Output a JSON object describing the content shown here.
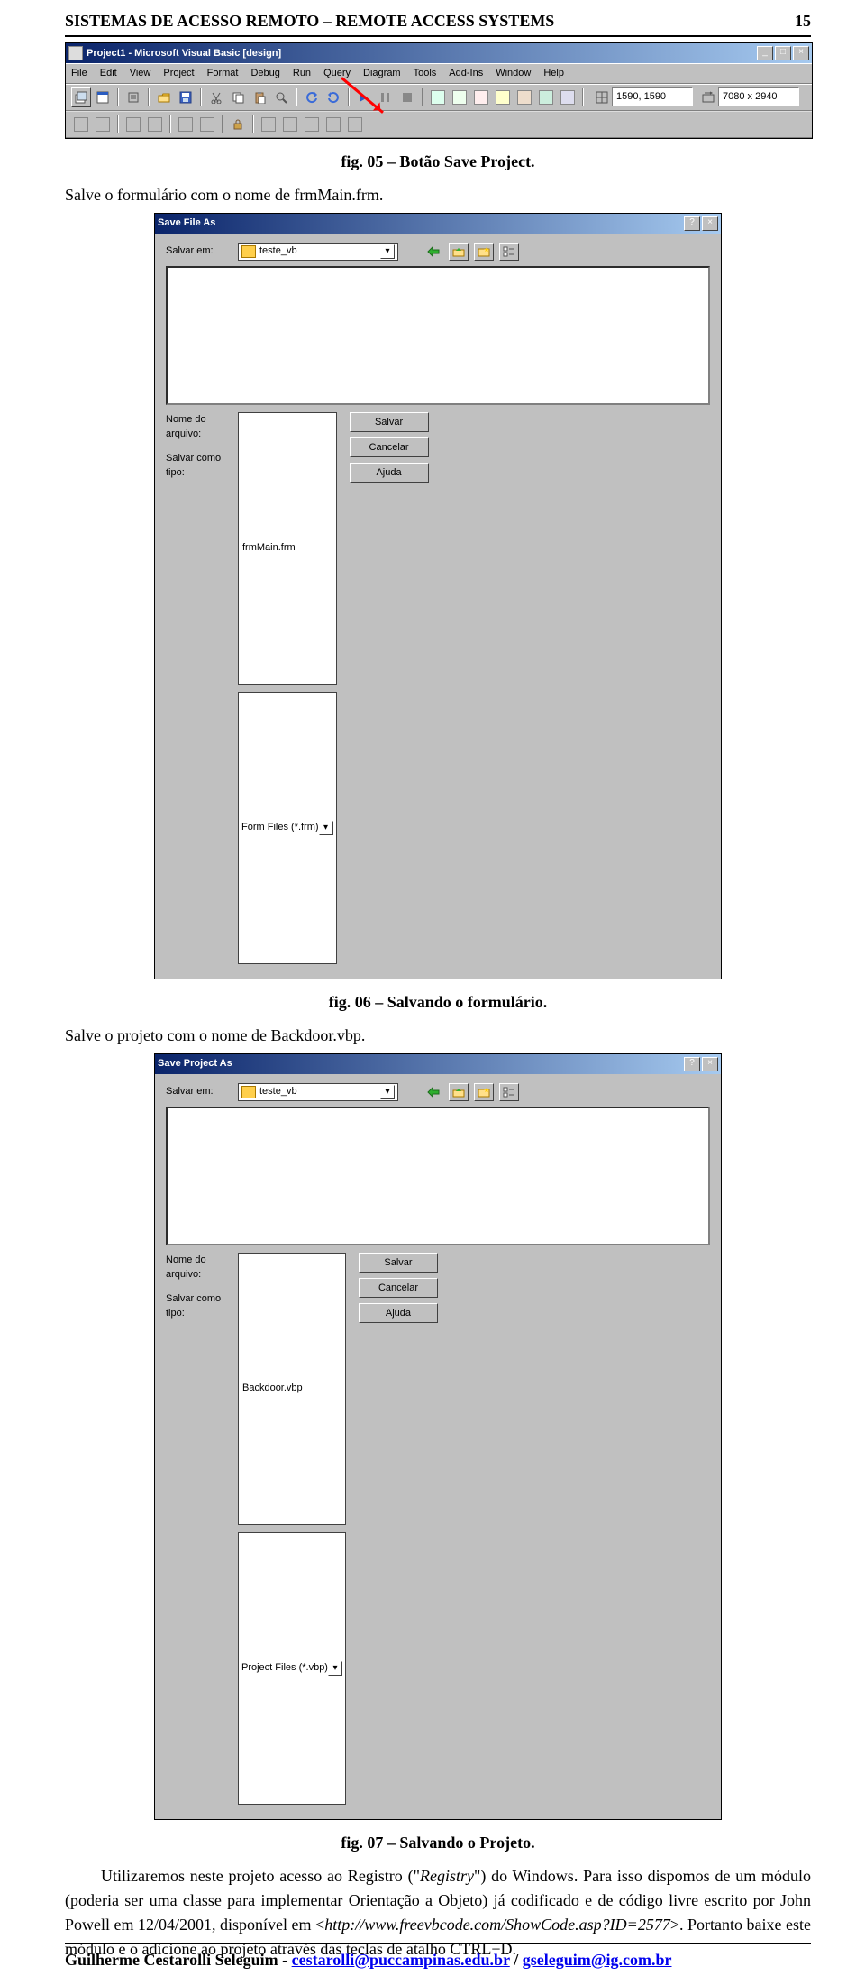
{
  "header": {
    "title": "SISTEMAS DE ACESSO REMOTO – REMOTE ACCESS SYSTEMS",
    "page_number": "15"
  },
  "captions": {
    "fig05": "fig. 05 – Botão Save Project.",
    "fig06": "fig. 06 – Salvando o formulário.",
    "fig07": "fig. 07 – Salvando o Projeto."
  },
  "body": {
    "line1": "Salve o formulário com o nome de frmMain.frm.",
    "line2": "Salve o projeto com o nome de Backdoor.vbp.",
    "para1_a": "Utilizaremos neste projeto acesso ao Registro (",
    "para1_reg": "Registry",
    "para1_b": ") do Windows. Para isso dispomos de um módulo (poderia ser uma classe para implementar Orientação a Objeto) já codificado e de código livre escrito por John Powell em 12/04/2001, disponível em <",
    "para1_url": "http://www.freevbcode.com/ShowCode.asp?ID=2577",
    "para1_c": ">. Portanto baixe este módulo e o adicione ao projeto através das teclas de atalho CTRL+D."
  },
  "vb_window": {
    "title": "Project1 - Microsoft Visual Basic [design]",
    "menu": [
      "File",
      "Edit",
      "View",
      "Project",
      "Format",
      "Debug",
      "Run",
      "Query",
      "Diagram",
      "Tools",
      "Add-Ins",
      "Window",
      "Help"
    ],
    "coords1": "1590, 1590",
    "coords2": "7080 x 2940"
  },
  "dlg1": {
    "title": "Save File As",
    "save_in_label": "Salvar em:",
    "folder": "teste_vb",
    "name_label": "Nome do arquivo:",
    "type_label": "Salvar como tipo:",
    "filename": "frmMain.frm",
    "filetype": "Form Files (*.frm)",
    "btn_save": "Salvar",
    "btn_cancel": "Cancelar",
    "btn_help": "Ajuda"
  },
  "dlg2": {
    "title": "Save Project As",
    "save_in_label": "Salvar em:",
    "folder": "teste_vb",
    "name_label": "Nome do arquivo:",
    "type_label": "Salvar como tipo:",
    "filename": "Backdoor.vbp",
    "filetype": "Project Files (*.vbp)",
    "btn_save": "Salvar",
    "btn_cancel": "Cancelar",
    "btn_help": "Ajuda"
  },
  "footer": {
    "author": "Guilherme Cestarolli Seleguim - ",
    "email1": "cestarolli@puccampinas.edu.br",
    "sep": " / ",
    "email2": "gseleguim@ig.com.br"
  }
}
